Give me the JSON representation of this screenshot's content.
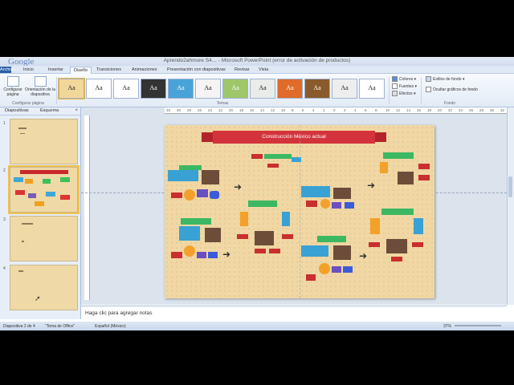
{
  "window": {
    "title": "Aprendo2ahmore S4… - Microsoft PowerPoint (error de activación de productos)",
    "logo": "Google"
  },
  "tabs": [
    "Archivo",
    "Inicio",
    "Insertar",
    "Diseño",
    "Transiciones",
    "Animaciones",
    "Presentación con diapositivas",
    "Revisar",
    "Vista"
  ],
  "ribbon": {
    "config_page": "Configurar página",
    "orientation": "Orientación de la diapositiva",
    "group_config": "Configurar página",
    "group_themes": "Temas",
    "group_background": "Fondo",
    "colors": "Colores",
    "fonts": "Fuentes",
    "effects": "Efectos",
    "bg_styles": "Estilos de fondo",
    "hide_bg": "Ocultar gráficos de fondo",
    "theme_sample": "Aa"
  },
  "side_panel": {
    "tab_slides": "Diapositivas",
    "tab_outline": "Esquema",
    "slide_numbers": [
      "1",
      "2",
      "3",
      "4"
    ]
  },
  "ruler": {
    "labels": [
      "33",
      "30",
      "28",
      "26",
      "24",
      "22",
      "20",
      "18",
      "16",
      "14",
      "12",
      "10",
      "8",
      "6",
      "4",
      "2",
      "0",
      "2",
      "4",
      "6",
      "8",
      "10",
      "12",
      "14",
      "16",
      "18",
      "20",
      "22",
      "24",
      "26",
      "28",
      "30",
      "32"
    ]
  },
  "slide": {
    "title": "Construcción México actual"
  },
  "notes": {
    "placeholder": "Haga clic para agregar notas"
  },
  "status": {
    "slide_info": "Diapositiva 2 de 4",
    "theme": "\"Tema de Office\"",
    "language": "Español (México)",
    "zoom": "37%"
  }
}
